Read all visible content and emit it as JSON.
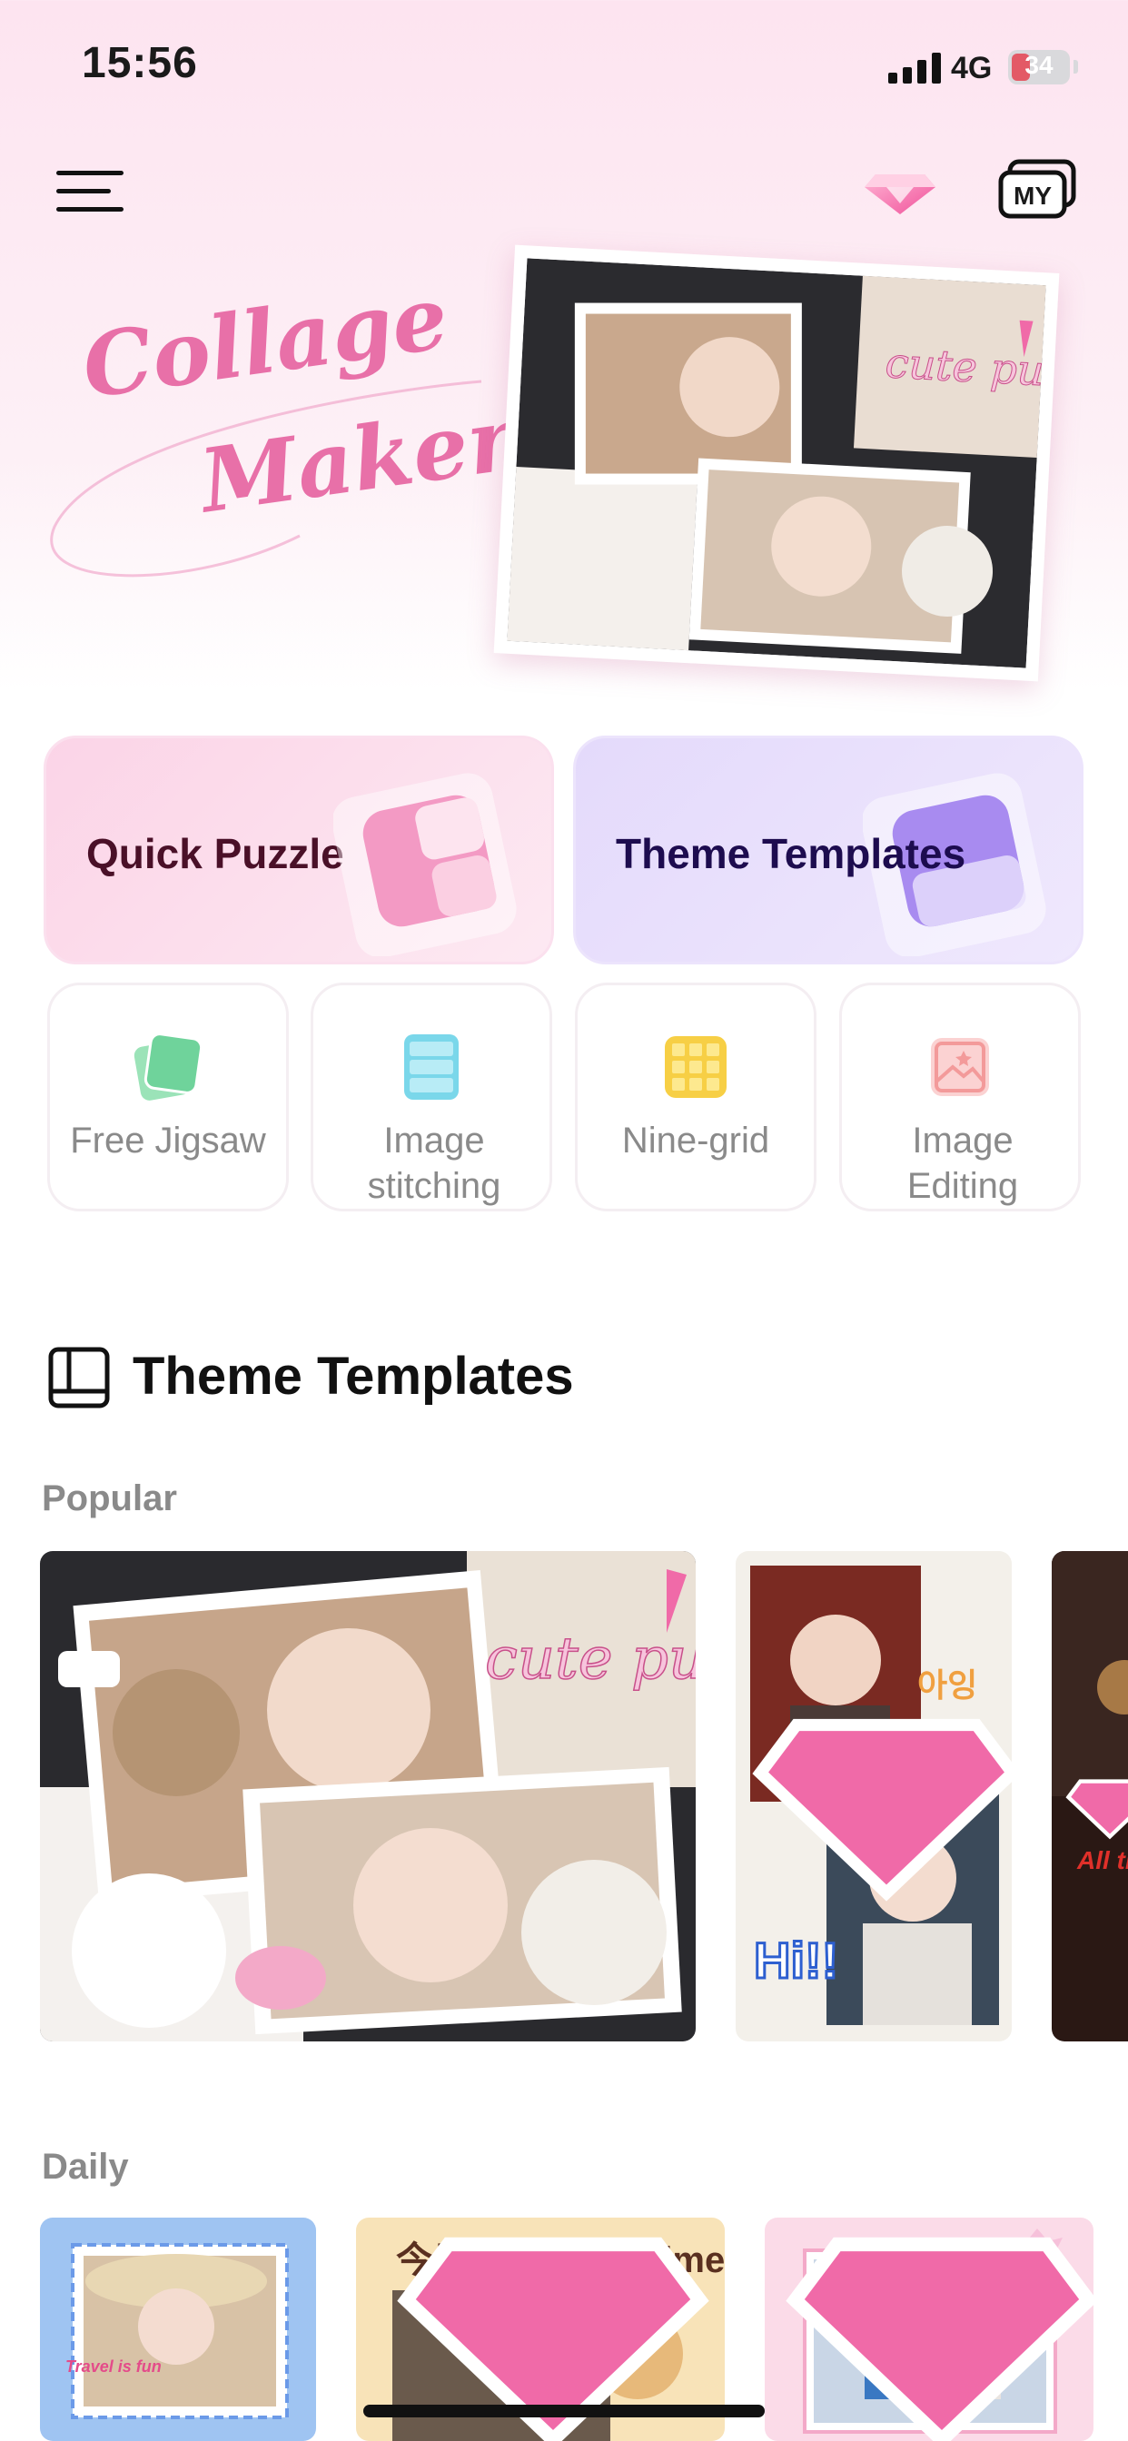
{
  "status_bar": {
    "time": "15:56",
    "network": "4G",
    "battery": "34"
  },
  "nav": {
    "menu_icon": "hamburger-menu-icon",
    "gem_icon": "diamond-vip-icon",
    "my_label": "MY"
  },
  "hero": {
    "title_line1": "Collage",
    "title_line2": "Maker",
    "card_caption": "cute puppy"
  },
  "features": {
    "primary": [
      {
        "label": "Quick Puzzle",
        "icon": "puzzle-card-icon"
      },
      {
        "label": "Theme Templates",
        "icon": "template-card-icon"
      }
    ],
    "secondary": [
      {
        "label": "Free Jigsaw",
        "icon": "free-jigsaw-icon"
      },
      {
        "label": "Image stitching",
        "icon": "image-stitching-icon"
      },
      {
        "label": "Nine-grid",
        "icon": "nine-grid-icon"
      },
      {
        "label": "Image Editing",
        "icon": "image-editing-icon"
      }
    ]
  },
  "section": {
    "title": "Theme Templates",
    "icon": "layout-icon"
  },
  "categories": {
    "popular": {
      "label": "Popular",
      "tiles": [
        {
          "caption": "cute puppy",
          "vip": false
        },
        {
          "caption": "Hi!!",
          "vip": true
        },
        {
          "caption": "All the best",
          "vip": true
        }
      ]
    },
    "daily": {
      "label": "Daily",
      "tiles": [
        {
          "caption": "Travel is fun",
          "vip": false
        },
        {
          "caption": "今日美食 Food time",
          "vip": true
        },
        {
          "caption": "",
          "vip": true
        }
      ]
    }
  },
  "colors": {
    "brand_pink": "#e870a8",
    "feature_pink": "#fbd4e7",
    "feature_purple": "#e4dafb",
    "muted_text": "#8a8a8a"
  }
}
